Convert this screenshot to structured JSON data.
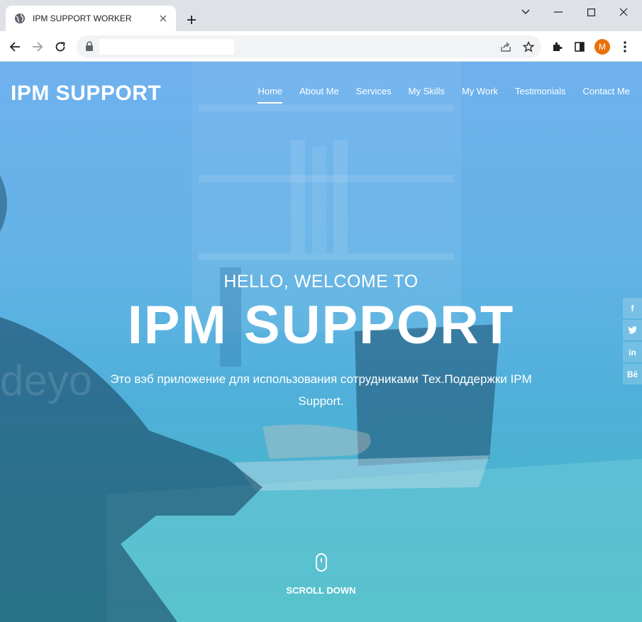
{
  "browser": {
    "tab_title": "IPM SUPPORT WORKER",
    "url": ""
  },
  "site": {
    "logo": "IPM SUPPORT",
    "nav": [
      "Home",
      "About Me",
      "Services",
      "My Skills",
      "My Work",
      "Testimonials",
      "Contact Me"
    ],
    "active_nav": "Home"
  },
  "hero": {
    "greeting": "HELLO, WELCOME TO",
    "title": "IPM SUPPORT",
    "description": "Это вэб приложение для использования сотрудниками Тех.Поддержки IPM Support.",
    "scroll_label": "SCROLL DOWN"
  },
  "social": [
    "f",
    "t",
    "in",
    "Bē"
  ],
  "avatar_initial": "M",
  "colors": {
    "hero_top": "#6fb1ee",
    "hero_bottom": "#43b8c2",
    "avatar": "#e8710a"
  }
}
